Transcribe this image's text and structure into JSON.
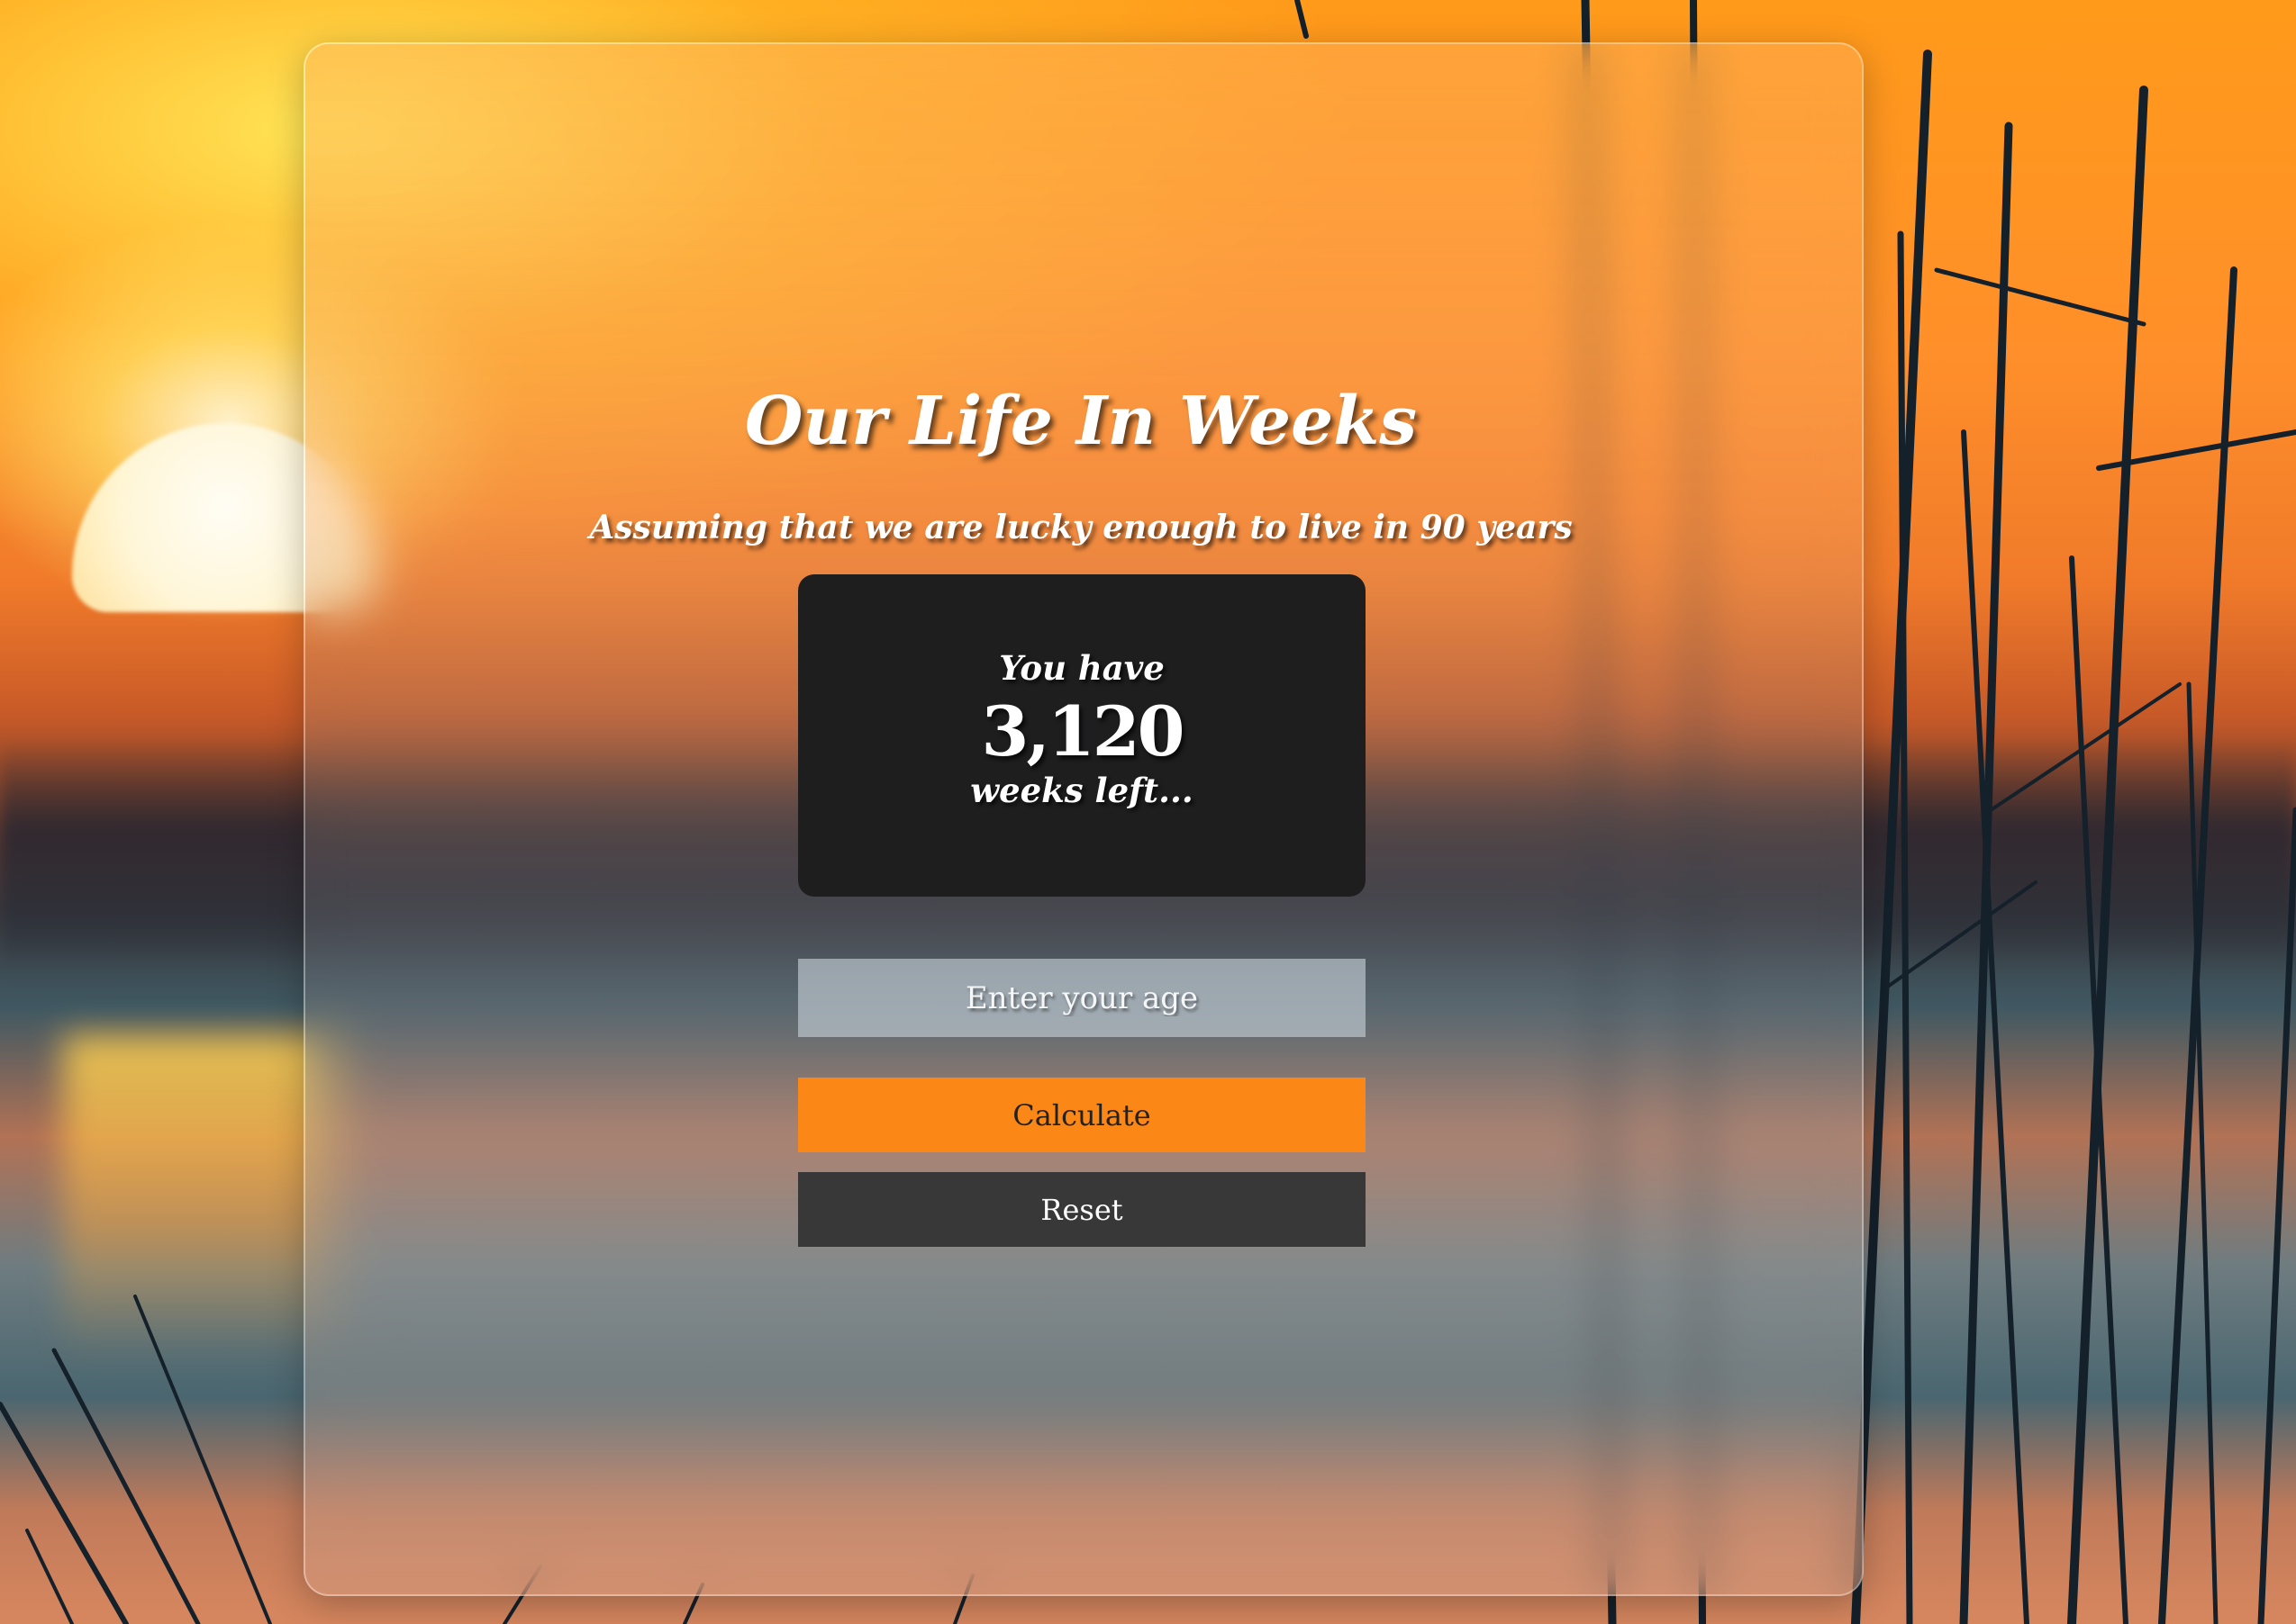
{
  "app": {
    "title": "Our Life In Weeks",
    "subtitle": "Assuming that we are lucky enough to live in 90 years"
  },
  "result": {
    "prefix": "You have",
    "weeks_left": "3,120",
    "suffix": "weeks left..."
  },
  "form": {
    "age_placeholder": "Enter your age",
    "age_value": "",
    "calculate_label": "Calculate",
    "reset_label": "Reset"
  },
  "colors": {
    "calculate_button": "#fb8716",
    "reset_button": "#383839",
    "result_box": "#1e1e1f"
  }
}
